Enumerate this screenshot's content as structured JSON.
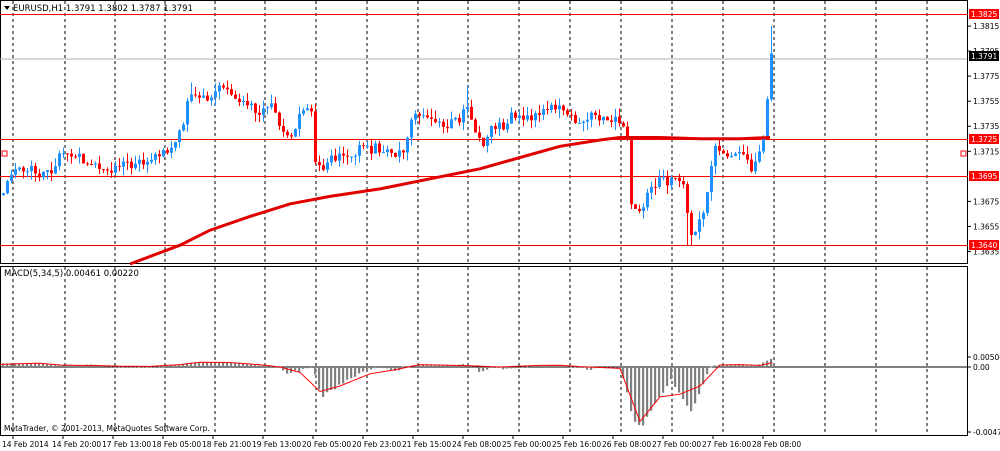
{
  "header": {
    "symbol_line": "EURUSD,H1  1.3791 1.3802 1.3787 1.3791",
    "indicator_line": "MACD(5,34,5) 0.00461 0.00220"
  },
  "copyright": "MetaTrader, © 2001-2013, MetaQuotes Software Corp.",
  "colors": {
    "bull_candle": "#1e90ff",
    "bear_candle": "#ff0000",
    "moving_average": "#e00000",
    "level_line": "#ff0000",
    "level_label_bg": "#ff0000",
    "price_label_bg": "#000000",
    "macd_histogram": "#808080",
    "macd_signal": "#ff0000",
    "grid": "#000000"
  },
  "icons": [
    "chevron-down-icon"
  ],
  "chart_data": [
    {
      "type": "candlestick",
      "symbol": "EURUSD",
      "timeframe": "H1",
      "ylim": [
        1.3625,
        1.3835
      ],
      "y_ticks": [
        "1.3815",
        "1.3795",
        "1.3775",
        "1.3755",
        "1.3735",
        "1.3715",
        "1.3675",
        "1.3655",
        "1.3635"
      ],
      "x_ticks": [
        "14 Feb 2014",
        "14 Feb 20:00",
        "17 Feb 13:00",
        "18 Feb 05:00",
        "18 Feb 21:00",
        "19 Feb 13:00",
        "20 Feb 05:00",
        "20 Feb 23:00",
        "21 Feb 15:00",
        "24 Feb 08:00",
        "25 Feb 00:00",
        "25 Feb 16:00",
        "26 Feb 08:00",
        "27 Feb 00:00",
        "27 Feb 16:00",
        "28 Feb 08:00"
      ],
      "horizontal_levels": [
        {
          "price": 1.3825,
          "label": "1.3825"
        },
        {
          "price": 1.3725,
          "label": "1.3725"
        },
        {
          "price": 1.3695,
          "label": "1.3695"
        },
        {
          "price": 1.364,
          "label": "1.3640"
        }
      ],
      "current_price": {
        "price": 1.3791,
        "label": "1.3791"
      },
      "close_path": [
        [
          0,
          1.368
        ],
        [
          15,
          1.3705
        ],
        [
          30,
          1.37
        ],
        [
          45,
          1.3695
        ],
        [
          60,
          1.3712
        ],
        [
          75,
          1.3712
        ],
        [
          90,
          1.3703
        ],
        [
          105,
          1.37
        ],
        [
          120,
          1.3705
        ],
        [
          135,
          1.3703
        ],
        [
          150,
          1.371
        ],
        [
          165,
          1.3713
        ],
        [
          175,
          1.3725
        ],
        [
          180,
          1.373
        ],
        [
          185,
          1.375
        ],
        [
          190,
          1.376
        ],
        [
          200,
          1.3757
        ],
        [
          210,
          1.3758
        ],
        [
          220,
          1.3767
        ],
        [
          230,
          1.3762
        ],
        [
          240,
          1.3757
        ],
        [
          250,
          1.3752
        ],
        [
          260,
          1.3745
        ],
        [
          270,
          1.375
        ],
        [
          280,
          1.3732
        ],
        [
          290,
          1.3728
        ],
        [
          300,
          1.3748
        ],
        [
          310,
          1.3745
        ],
        [
          312,
          1.3712
        ],
        [
          320,
          1.37
        ],
        [
          330,
          1.3708
        ],
        [
          340,
          1.3715
        ],
        [
          350,
          1.3712
        ],
        [
          360,
          1.3718
        ],
        [
          370,
          1.3717
        ],
        [
          380,
          1.3718
        ],
        [
          390,
          1.3712
        ],
        [
          400,
          1.3712
        ],
        [
          410,
          1.374
        ],
        [
          420,
          1.3748
        ],
        [
          430,
          1.374
        ],
        [
          440,
          1.3738
        ],
        [
          450,
          1.3737
        ],
        [
          460,
          1.374
        ],
        [
          465,
          1.3758
        ],
        [
          470,
          1.374
        ],
        [
          480,
          1.372
        ],
        [
          490,
          1.3735
        ],
        [
          500,
          1.3735
        ],
        [
          510,
          1.3742
        ],
        [
          520,
          1.374
        ],
        [
          530,
          1.374
        ],
        [
          540,
          1.3745
        ],
        [
          550,
          1.375
        ],
        [
          560,
          1.3752
        ],
        [
          570,
          1.3742
        ],
        [
          580,
          1.374
        ],
        [
          590,
          1.3742
        ],
        [
          600,
          1.374
        ],
        [
          610,
          1.374
        ],
        [
          620,
          1.3738
        ],
        [
          625,
          1.3735
        ],
        [
          630,
          1.3672
        ],
        [
          640,
          1.3665
        ],
        [
          650,
          1.3688
        ],
        [
          660,
          1.3692
        ],
        [
          670,
          1.369
        ],
        [
          680,
          1.3695
        ],
        [
          690,
          1.365
        ],
        [
          700,
          1.366
        ],
        [
          708,
          1.369
        ],
        [
          712,
          1.3718
        ],
        [
          720,
          1.3712
        ],
        [
          730,
          1.371
        ],
        [
          740,
          1.3712
        ],
        [
          750,
          1.3703
        ],
        [
          760,
          1.3718
        ],
        [
          765,
          1.374
        ],
        [
          768,
          1.379
        ],
        [
          772,
          1.3791
        ]
      ],
      "spikes": [
        [
          688,
          1.364
        ],
        [
          770,
          1.3815
        ],
        [
          465,
          1.3768
        ],
        [
          190,
          1.377
        ]
      ],
      "moving_average_path": [
        [
          130,
          1.3625
        ],
        [
          180,
          1.364
        ],
        [
          210,
          1.3652
        ],
        [
          250,
          1.3663
        ],
        [
          290,
          1.3673
        ],
        [
          330,
          1.3679
        ],
        [
          380,
          1.3685
        ],
        [
          430,
          1.3693
        ],
        [
          480,
          1.3701
        ],
        [
          520,
          1.371
        ],
        [
          560,
          1.3719
        ],
        [
          600,
          1.3724
        ],
        [
          620,
          1.3726
        ],
        [
          660,
          1.3726
        ],
        [
          700,
          1.3725
        ],
        [
          740,
          1.3725
        ],
        [
          770,
          1.3726
        ]
      ]
    },
    {
      "type": "bar",
      "name": "MACD(5,34,5)",
      "macd_value": 0.00461,
      "signal_value": 0.0022,
      "ylim": [
        -0.00478,
        0.00506
      ],
      "y_ticks": [
        "0.00506",
        "0.00",
        "-0.00478"
      ],
      "histogram_path": [
        [
          0,
          0.0018
        ],
        [
          20,
          0.0018
        ],
        [
          35,
          0.0022
        ],
        [
          45,
          0.0018
        ],
        [
          55,
          0.001
        ],
        [
          65,
          0.0007
        ],
        [
          80,
          0.001
        ],
        [
          90,
          0.0012
        ],
        [
          100,
          0.0008
        ],
        [
          110,
          0.0005
        ],
        [
          120,
          0.0003
        ],
        [
          140,
          0.0003
        ],
        [
          160,
          0.0003
        ],
        [
          175,
          0.0012
        ],
        [
          190,
          0.0022
        ],
        [
          205,
          0.0026
        ],
        [
          225,
          0.0024
        ],
        [
          240,
          0.0018
        ],
        [
          255,
          0.001
        ],
        [
          270,
          0.0004
        ],
        [
          285,
          -0.0004
        ],
        [
          300,
          -0.0003
        ],
        [
          312,
          0.0001
        ],
        [
          320,
          -0.0022
        ],
        [
          335,
          -0.0015
        ],
        [
          350,
          -0.0008
        ],
        [
          365,
          -0.0002
        ],
        [
          380,
          0.0001
        ],
        [
          395,
          -0.0004
        ],
        [
          410,
          0.0008
        ],
        [
          420,
          0.0012
        ],
        [
          435,
          0.001
        ],
        [
          450,
          0.0008
        ],
        [
          462,
          0.0015
        ],
        [
          470,
          0.0005
        ],
        [
          480,
          -0.0005
        ],
        [
          490,
          0.0001
        ],
        [
          500,
          -0.0001
        ],
        [
          520,
          0.0
        ],
        [
          535,
          0.0008
        ],
        [
          550,
          0.0011
        ],
        [
          560,
          0.0008
        ],
        [
          575,
          0.0001
        ],
        [
          590,
          -0.0002
        ],
        [
          605,
          0.0
        ],
        [
          620,
          -0.0001
        ],
        [
          632,
          -0.0038
        ],
        [
          640,
          -0.0045
        ],
        [
          655,
          -0.0025
        ],
        [
          670,
          -0.001
        ],
        [
          690,
          -0.0032
        ],
        [
          700,
          -0.0018
        ],
        [
          712,
          0.0008
        ],
        [
          725,
          0.0012
        ],
        [
          740,
          0.0012
        ],
        [
          755,
          0.0005
        ],
        [
          765,
          0.003
        ],
        [
          772,
          0.0046
        ]
      ],
      "signal_path": [
        [
          0,
          0.0013
        ],
        [
          20,
          0.0016
        ],
        [
          40,
          0.0019
        ],
        [
          60,
          0.001
        ],
        [
          80,
          0.0008
        ],
        [
          100,
          0.0007
        ],
        [
          120,
          0.0004
        ],
        [
          150,
          0.0003
        ],
        [
          180,
          0.0012
        ],
        [
          200,
          0.0024
        ],
        [
          230,
          0.0023
        ],
        [
          260,
          0.0011
        ],
        [
          280,
          0.0
        ],
        [
          300,
          -0.0004
        ],
        [
          320,
          -0.0018
        ],
        [
          340,
          -0.0014
        ],
        [
          370,
          -0.0005
        ],
        [
          395,
          -0.0002
        ],
        [
          420,
          0.0012
        ],
        [
          450,
          0.0009
        ],
        [
          470,
          0.0006
        ],
        [
          500,
          0.0
        ],
        [
          540,
          0.0008
        ],
        [
          560,
          0.0009
        ],
        [
          580,
          0.0002
        ],
        [
          620,
          -0.0001
        ],
        [
          640,
          -0.004
        ],
        [
          660,
          -0.0022
        ],
        [
          680,
          -0.002
        ],
        [
          700,
          -0.0014
        ],
        [
          720,
          0.001
        ],
        [
          740,
          0.0012
        ],
        [
          760,
          0.0008
        ],
        [
          772,
          0.0022
        ]
      ]
    }
  ]
}
